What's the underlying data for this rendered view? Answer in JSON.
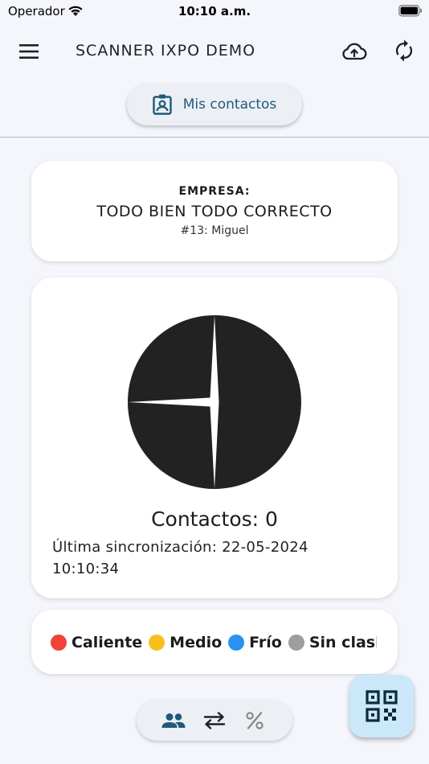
{
  "status_bar": {
    "carrier": "Operador",
    "time": "10:10 a.m."
  },
  "app_bar": {
    "title": "SCANNER IXPO DEMO",
    "icons": [
      "menu-icon",
      "cloud-upload-icon",
      "sync-icon"
    ]
  },
  "contacts_button": {
    "label": "Mis contactos",
    "icon": "contact-badge-icon"
  },
  "company": {
    "label": "EMPRESA:",
    "name": "TODO BIEN TODO CORRECTO",
    "user": "#13: Miguel"
  },
  "summary": {
    "contacts_label": "Contactos: 0",
    "last_sync": "Última sincronización: 22-05-2024 10:10:34"
  },
  "chart_data": {
    "type": "pie",
    "series": [
      {
        "label": "",
        "value": 2
      },
      {
        "label": "",
        "value": 1
      },
      {
        "label": "",
        "value": 1
      }
    ],
    "colors": [
      "#222222",
      "#222222",
      "#222222"
    ]
  },
  "legend": [
    {
      "label": "Caliente",
      "color": "#f14336"
    },
    {
      "label": "Medio",
      "color": "#f9c01d"
    },
    {
      "label": "Frío",
      "color": "#2a93ef"
    },
    {
      "label": "Sin clasificar",
      "color": "#9e9e9e"
    }
  ],
  "bottom_nav": {
    "icons": [
      "people-icon",
      "swap-icon",
      "percent-icon"
    ],
    "active_color": "#1f5a78"
  },
  "fab": {
    "icon": "qr-code-icon",
    "color": "#cbe8fb"
  }
}
